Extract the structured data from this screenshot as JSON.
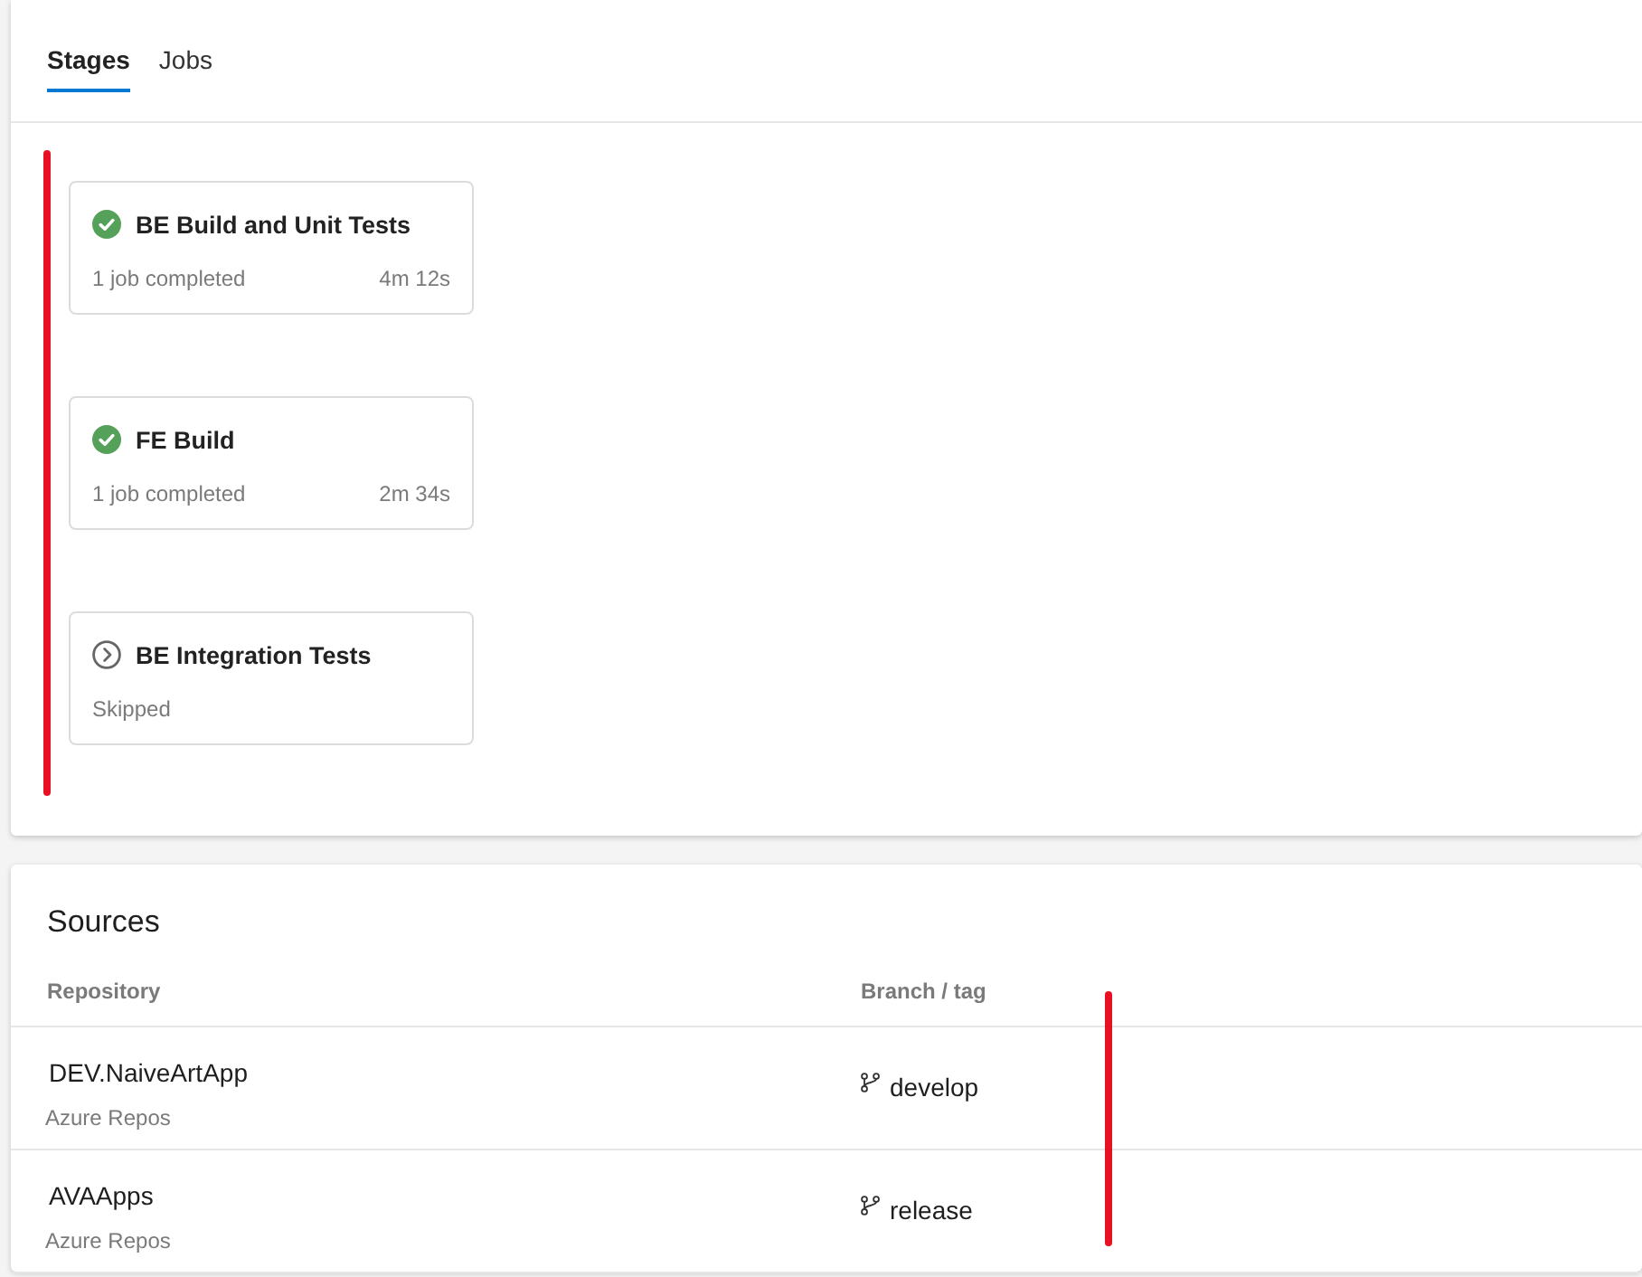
{
  "tabs": [
    {
      "label": "Stages",
      "selected": true
    },
    {
      "label": "Jobs",
      "selected": false
    }
  ],
  "stages": {
    "highlighted": true,
    "items": [
      {
        "name": "BE Build and Unit Tests",
        "kind": "succeeded",
        "summary": "1 job completed",
        "duration": "4m 12s"
      },
      {
        "name": "FE Build",
        "kind": "succeeded",
        "summary": "1 job completed",
        "duration": "2m 34s"
      },
      {
        "name": "BE Integration Tests",
        "kind": "skipped",
        "summary": "Skipped"
      }
    ]
  },
  "sources": {
    "title": "Sources",
    "columns": [
      "Repository",
      "Branch / tag"
    ],
    "branch_highlighted": true,
    "rows": [
      {
        "repository": "DEV.NaiveArtApp",
        "provider": "Azure Repos",
        "branch": "develop"
      },
      {
        "repository": "AVAApps",
        "provider": "Azure Repos",
        "branch": "release"
      }
    ]
  }
}
